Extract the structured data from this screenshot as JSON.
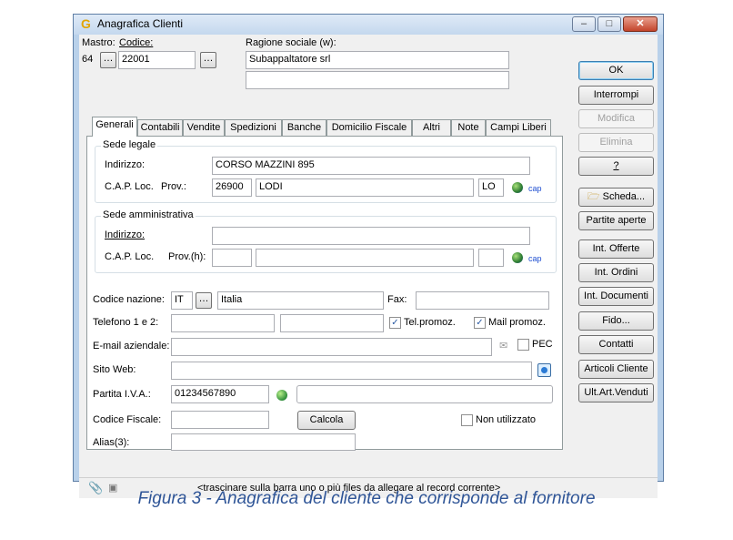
{
  "window": {
    "title": "Anagrafica Clienti"
  },
  "header": {
    "mastro_label": "Mastro:",
    "codice_label": "Codice:",
    "ragione_label": "Ragione sociale (w):",
    "mastro_value": "64",
    "codice_value": "22001",
    "ragione_value": "Subappaltatore srl",
    "ragione_value2": ""
  },
  "tabs": [
    "Generali",
    "Contabili",
    "Vendite",
    "Spedizioni",
    "Banche",
    "Domicilio Fiscale",
    "Altri",
    "Note",
    "Campi Liberi"
  ],
  "sede_legale": {
    "title": "Sede legale",
    "indirizzo_label": "Indirizzo:",
    "indirizzo_value": "CORSO MAZZINI 895",
    "cap_label": "C.A.P.",
    "loc_label": "Loc.",
    "prov_label": "Prov.:",
    "cap_value": "26900",
    "loc_value": "LODI",
    "prov_value": "LO",
    "cap_link": "cap"
  },
  "sede_amministrativa": {
    "title": "Sede amministrativa",
    "indirizzo_label": "Indirizzo:",
    "indirizzo_value": "",
    "cap_label": "C.A.P. Loc.",
    "prov_label": "Prov.(h):",
    "cap_link": "cap"
  },
  "fields": {
    "nazione_label": "Codice nazione:",
    "nazione_code": "IT",
    "nazione_name": "Italia",
    "fax_label": "Fax:",
    "telefono_label": "Telefono 1 e 2:",
    "telpromoz_label": "Tel.promoz.",
    "mailpromoz_label": "Mail promoz.",
    "email_label": "E-mail aziendale:",
    "pec_label": "PEC",
    "sito_label": "Sito Web:",
    "piva_label": "Partita I.V.A.:",
    "piva_value": "01234567890",
    "cf_label": "Codice Fiscale:",
    "calcola_label": "Calcola",
    "non_utilizzato_label": "Non utilizzato",
    "alias_label": "Alias(3):"
  },
  "buttons": {
    "ok": "OK",
    "interrompi": "Interrompi",
    "modifica": "Modifica",
    "elimina": "Elimina",
    "help": "?",
    "scheda": "Scheda...",
    "partite": "Partite aperte",
    "offerte": "Int. Offerte",
    "ordini": "Int. Ordini",
    "documenti": "Int. Documenti",
    "fido": "Fido...",
    "contatti": "Contatti",
    "articoli": "Articoli Cliente",
    "venduti": "Ult.Art.Venduti"
  },
  "statusbar": {
    "text": "<trascinare sulla barra uno o più files da allegare al record corrente>"
  },
  "caption": "Figura 3 - Anagrafica del cliente che corrisponde al fornitore",
  "colors": {
    "caption": "#2f5597",
    "cap_link": "#1f4fd1"
  }
}
